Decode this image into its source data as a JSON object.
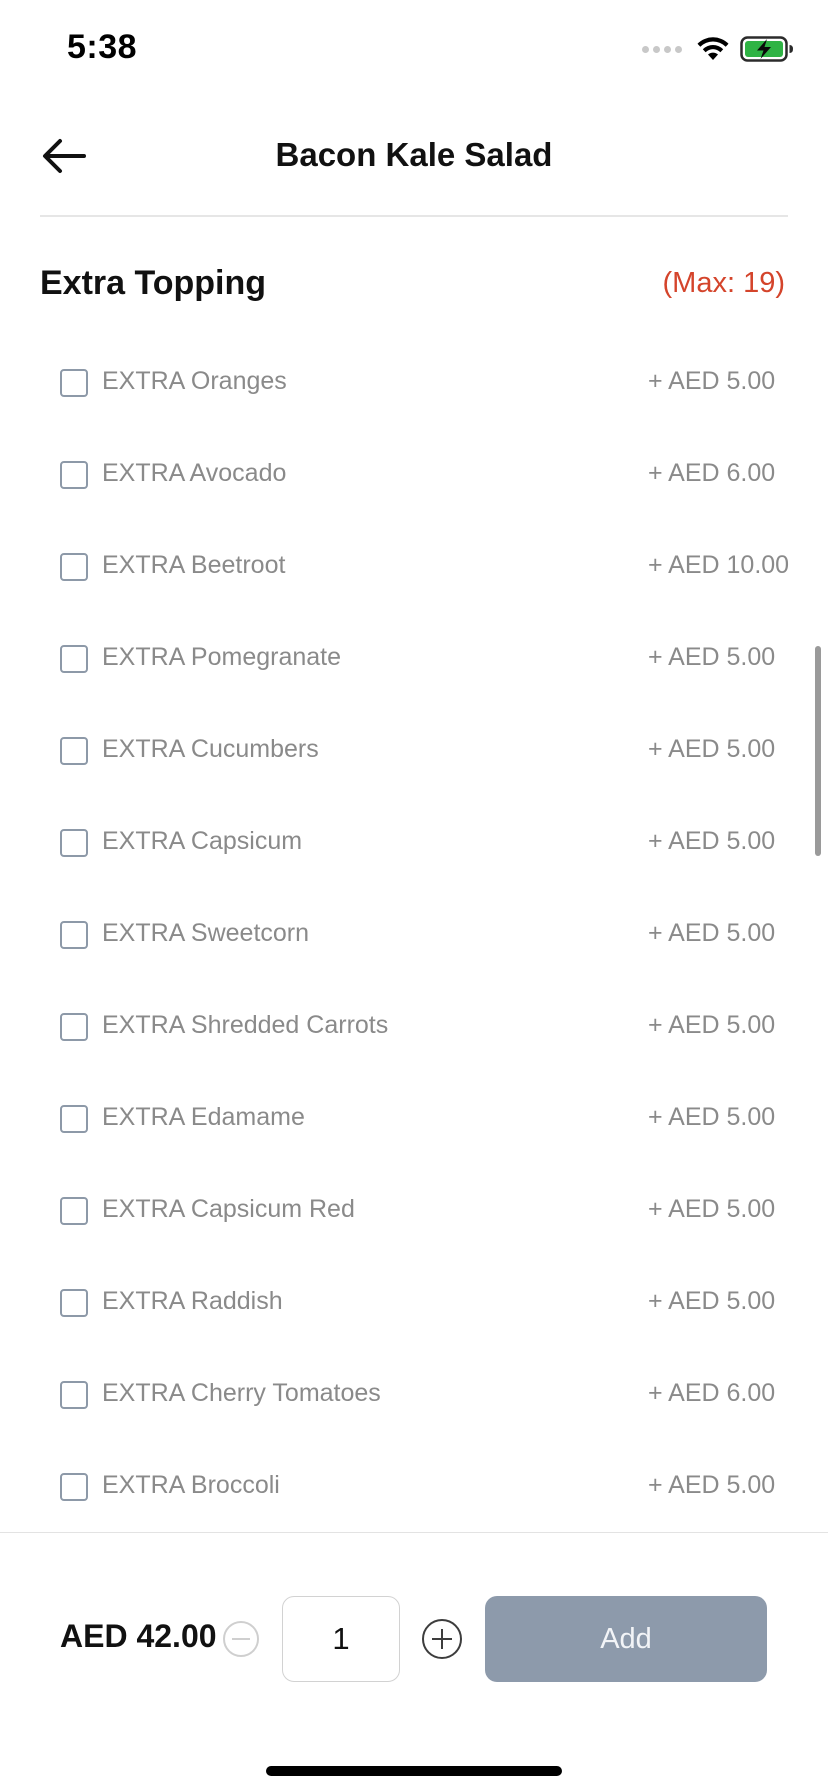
{
  "status_bar": {
    "time": "5:38",
    "icons": [
      "signal-dots-icon",
      "wifi-icon",
      "battery-charging-icon"
    ],
    "battery_color": "#2fb344"
  },
  "header": {
    "title": "Bacon Kale Salad",
    "back_icon": "arrow-left-icon"
  },
  "section": {
    "title": "Extra Topping",
    "max_label": "(Max: 19)",
    "max_color": "#d4442b"
  },
  "options": [
    {
      "label": "EXTRA Oranges",
      "price": "+ AED 5.00",
      "checked": false
    },
    {
      "label": "EXTRA Avocado",
      "price": "+ AED 6.00",
      "checked": false
    },
    {
      "label": "EXTRA Beetroot",
      "price": "+ AED 10.00",
      "checked": false
    },
    {
      "label": "EXTRA Pomegranate",
      "price": "+ AED 5.00",
      "checked": false
    },
    {
      "label": "EXTRA Cucumbers",
      "price": "+ AED 5.00",
      "checked": false
    },
    {
      "label": "EXTRA Capsicum",
      "price": "+ AED 5.00",
      "checked": false
    },
    {
      "label": "EXTRA Sweetcorn",
      "price": "+ AED 5.00",
      "checked": false
    },
    {
      "label": "EXTRA Shredded Carrots",
      "price": "+ AED 5.00",
      "checked": false
    },
    {
      "label": "EXTRA Edamame",
      "price": "+ AED 5.00",
      "checked": false
    },
    {
      "label": "EXTRA Capsicum Red",
      "price": "+ AED 5.00",
      "checked": false
    },
    {
      "label": "EXTRA Raddish",
      "price": "+ AED 5.00",
      "checked": false
    },
    {
      "label": "EXTRA Cherry Tomatoes",
      "price": "+ AED 6.00",
      "checked": false
    },
    {
      "label": "EXTRA Broccoli",
      "price": "+ AED 5.00",
      "checked": false
    }
  ],
  "footer": {
    "total": "AED 42.00",
    "quantity": "1",
    "add_label": "Add",
    "add_button_color": "#8d9aab"
  }
}
